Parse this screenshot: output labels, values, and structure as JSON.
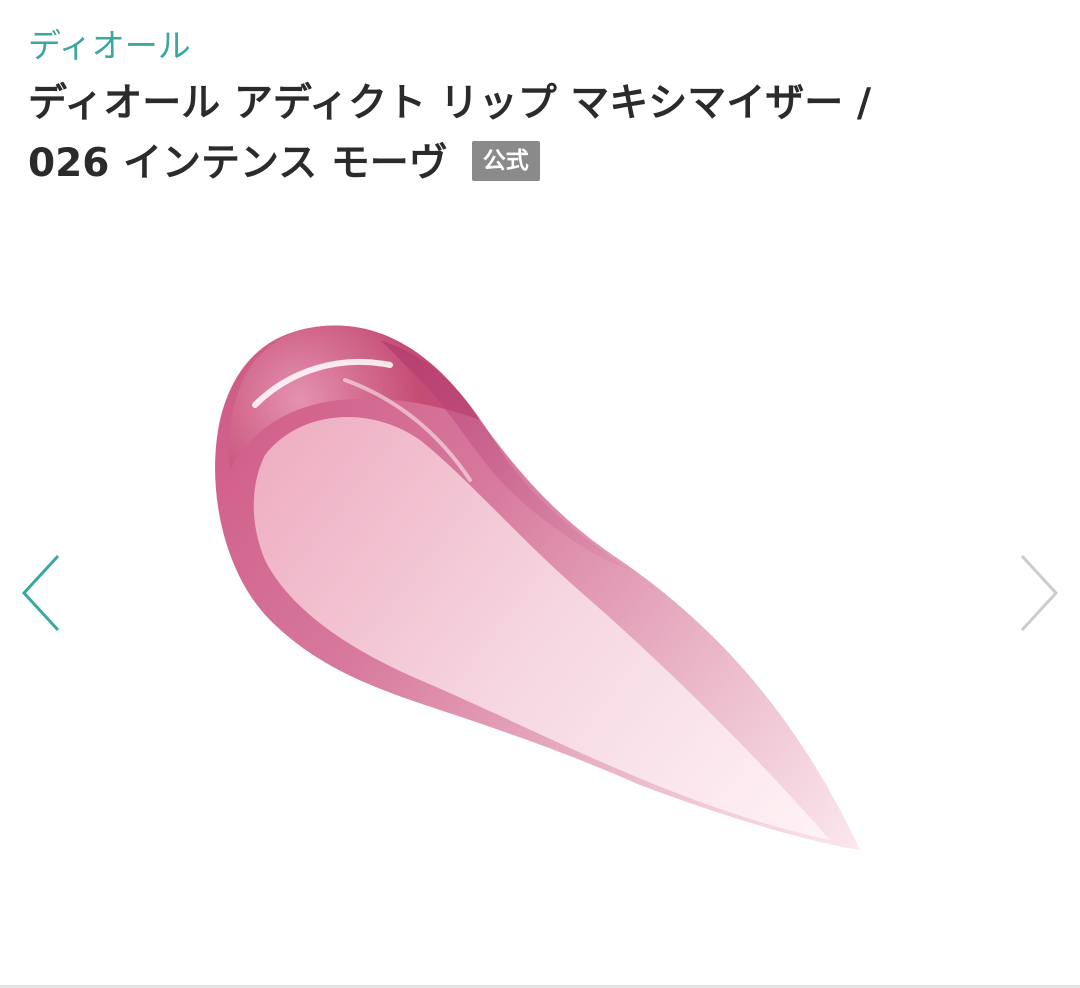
{
  "product": {
    "brand": "ディオール",
    "title_line1": "ディオール アディクト リップ マキシマイザー /",
    "title_line2": "026 インテンス モーヴ",
    "badge": "公式"
  },
  "gallery": {
    "image_icon": "lip-gloss-swatch",
    "prev_icon": "chevron-left-icon",
    "next_icon": "chevron-right-icon",
    "prev_color": "#3aa7a1",
    "next_color": "#cccccc"
  },
  "colors": {
    "brand_accent": "#3aa7a1",
    "title_text": "#2b2b2b",
    "badge_bg": "#8a8a8a"
  }
}
